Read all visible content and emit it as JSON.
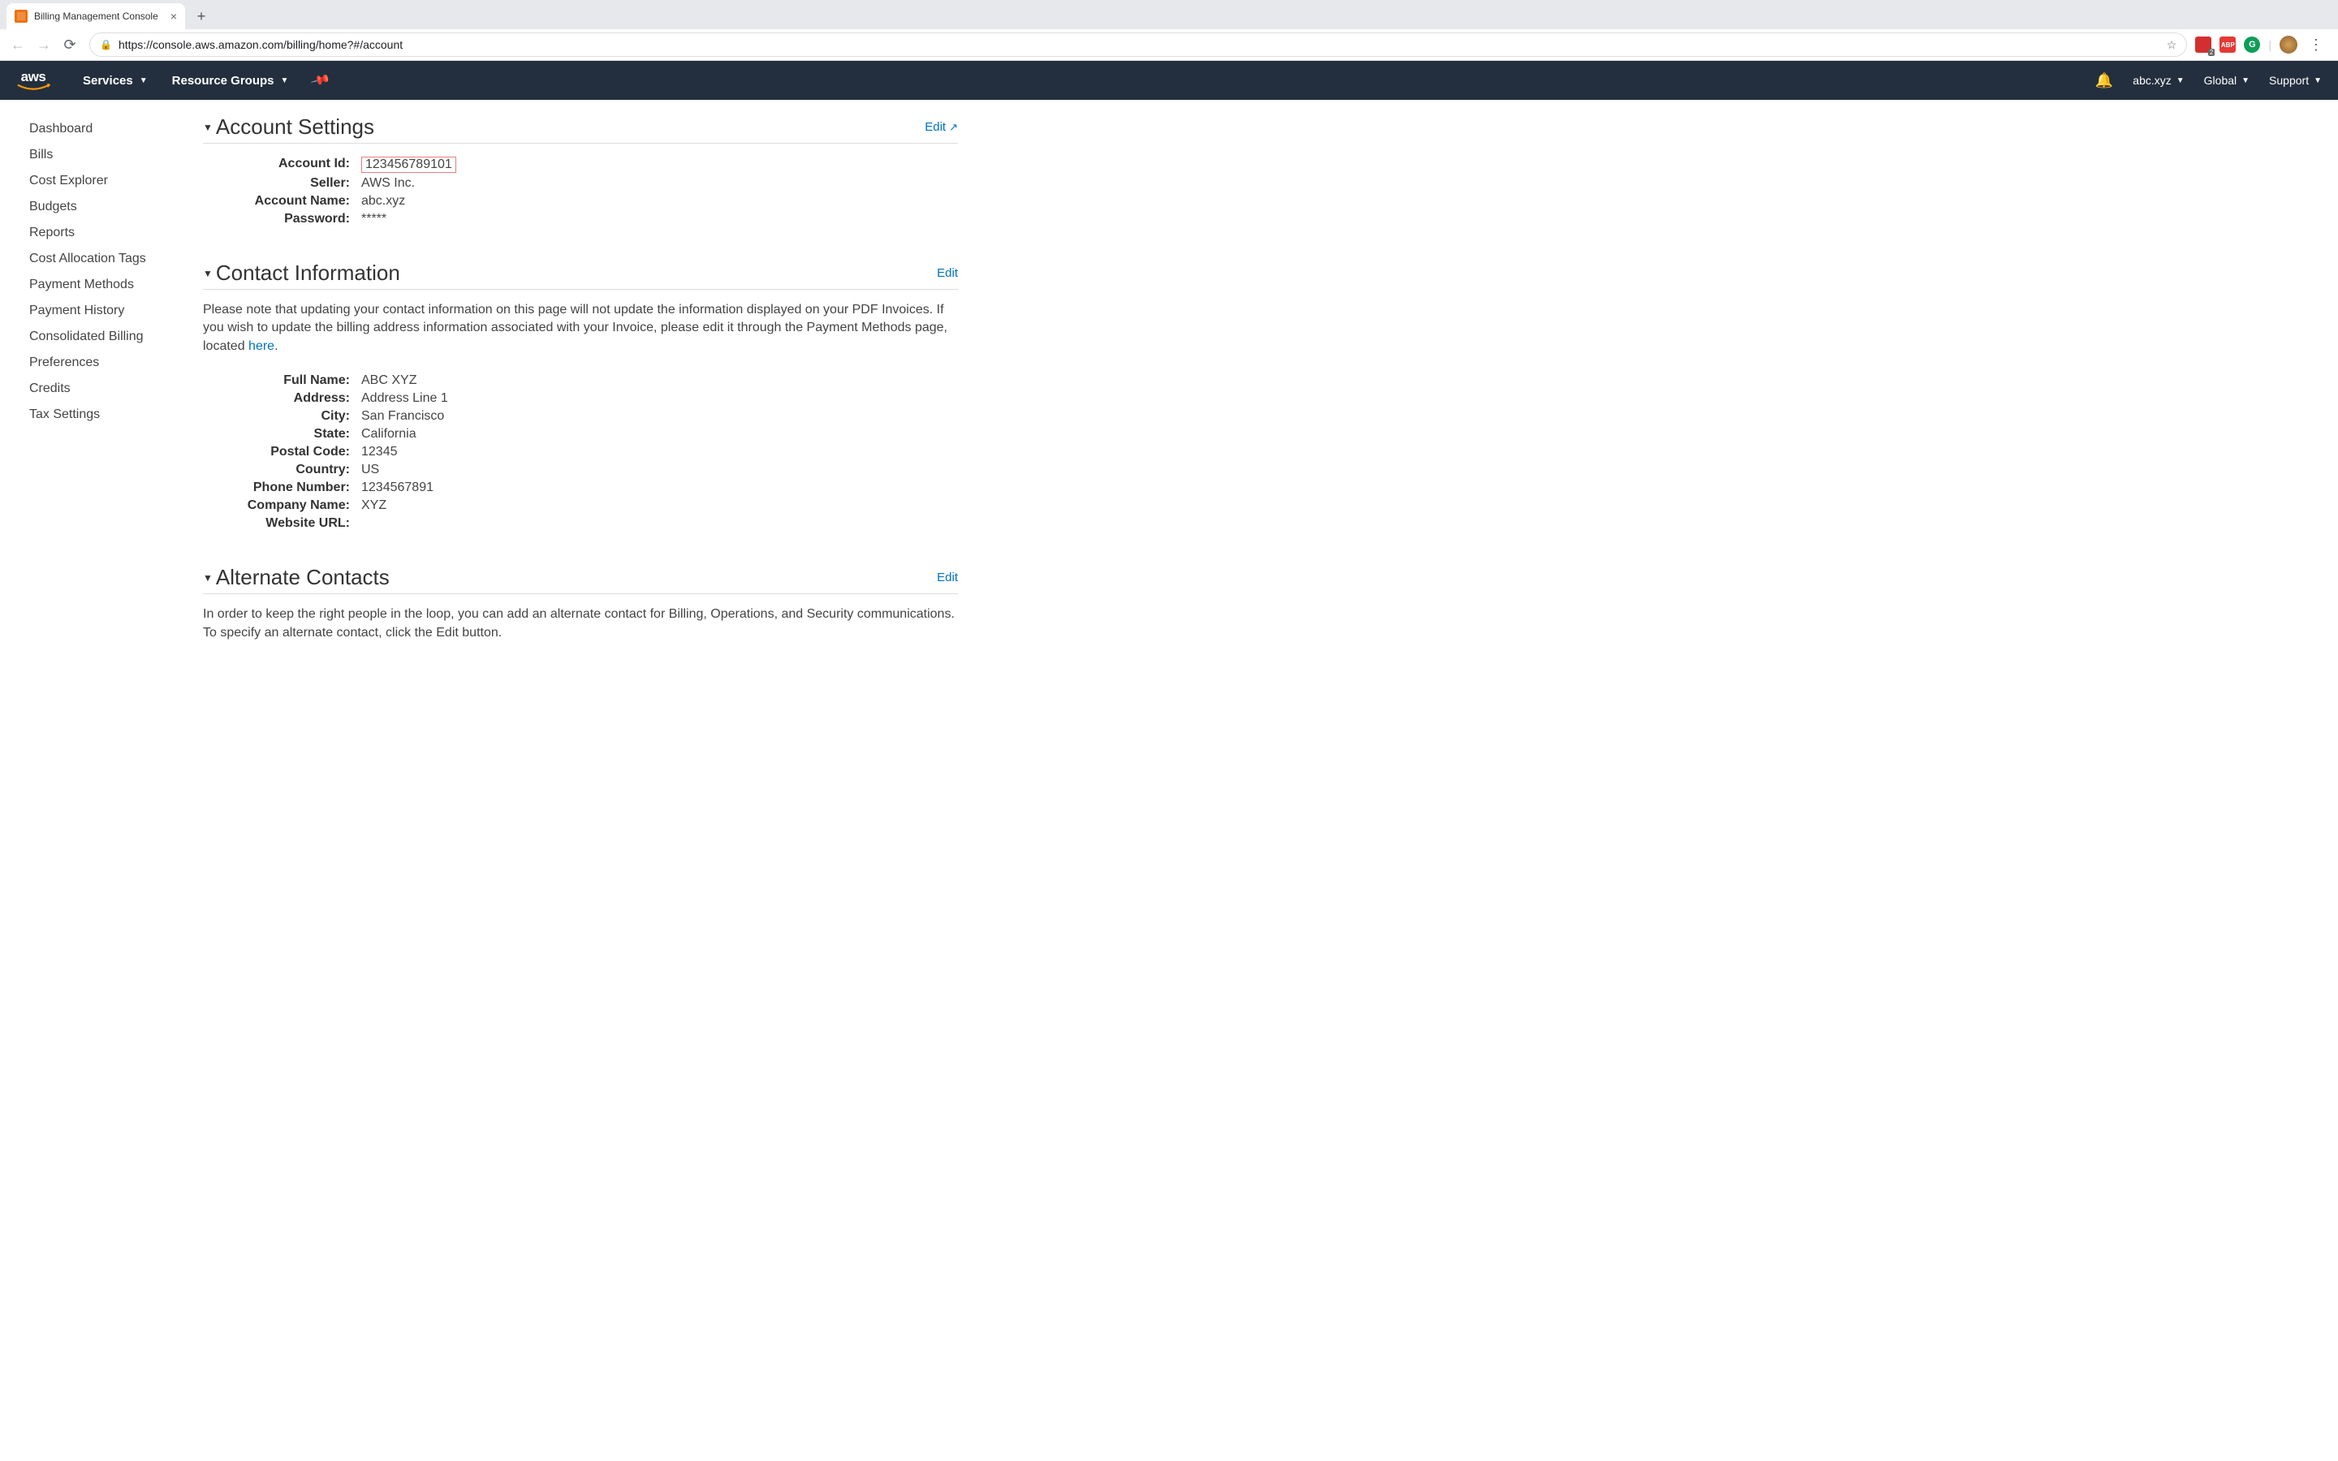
{
  "browser": {
    "tab_title": "Billing Management Console",
    "url": "https://console.aws.amazon.com/billing/home?#/account",
    "ext_abp": "ABP",
    "ext_g": "G",
    "ext_badge": "2"
  },
  "nav": {
    "logo": "aws",
    "services": "Services",
    "resource_groups": "Resource Groups",
    "account": "abc.xyz",
    "region": "Global",
    "support": "Support"
  },
  "sidebar": {
    "items": [
      "Dashboard",
      "Bills",
      "Cost Explorer",
      "Budgets",
      "Reports",
      "Cost Allocation Tags",
      "Payment Methods",
      "Payment History",
      "Consolidated Billing",
      "Preferences",
      "Credits",
      "Tax Settings"
    ]
  },
  "account_settings": {
    "title": "Account Settings",
    "edit": "Edit",
    "labels": {
      "account_id": "Account Id:",
      "seller": "Seller:",
      "account_name": "Account Name:",
      "password": "Password:"
    },
    "values": {
      "account_id": "123456789101",
      "seller": "AWS Inc.",
      "account_name": "abc.xyz",
      "password": "*****"
    }
  },
  "contact": {
    "title": "Contact Information",
    "edit": "Edit",
    "note_pre": "Please note that updating your contact information on this page will not update the information displayed on your PDF Invoices. If you wish to update the billing address information associated with your Invoice, please edit it through the Payment Methods page, located ",
    "note_link": "here",
    "note_post": ".",
    "labels": {
      "full_name": "Full Name:",
      "address": "Address:",
      "city": "City:",
      "state": "State:",
      "postal": "Postal Code:",
      "country": "Country:",
      "phone": "Phone Number:",
      "company": "Company Name:",
      "website": "Website URL:"
    },
    "values": {
      "full_name": "ABC XYZ",
      "address": "Address Line 1",
      "city": "San Francisco",
      "state": "California",
      "postal": "12345",
      "country": "US",
      "phone": "1234567891",
      "company": "XYZ",
      "website": ""
    }
  },
  "alternate": {
    "title": "Alternate Contacts",
    "edit": "Edit",
    "note": "In order to keep the right people in the loop, you can add an alternate contact for Billing, Operations, and Security communications. To specify an alternate contact, click the Edit button."
  }
}
